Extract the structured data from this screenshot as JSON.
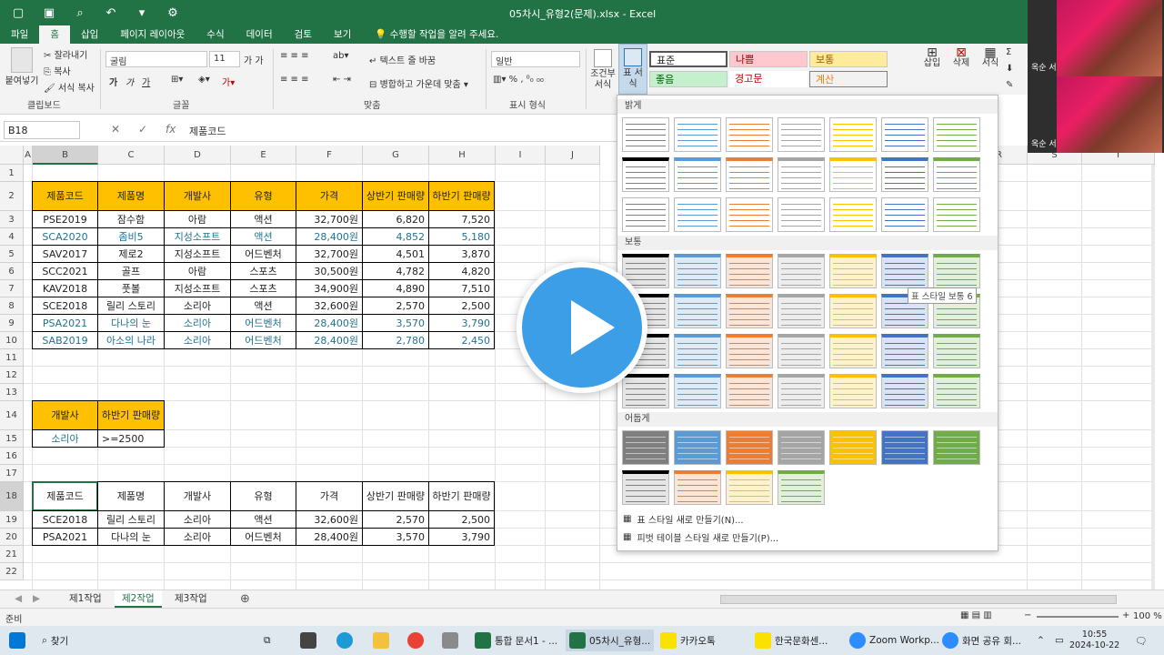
{
  "window": {
    "title": "05차시_유형2(문제).xlsx - Excel"
  },
  "ribbon_tabs": [
    "파일",
    "홈",
    "삽입",
    "페이지 레이아웃",
    "수식",
    "데이터",
    "검토",
    "보기"
  ],
  "tell_me": "수행할 작업을 알려 주세요.",
  "ribbon": {
    "clipboard": {
      "paste": "붙여넣기",
      "cut": "잘라내기",
      "copy": "복사",
      "format_painter": "서식 복사",
      "label": "클립보드"
    },
    "font": {
      "name": "굴림",
      "size": "11",
      "label": "글꼴",
      "bold": "가",
      "italic": "가",
      "underline": "가"
    },
    "alignment": {
      "wrap": "텍스트 줄 바꿈",
      "merge": "병합하고 가운데 맞춤",
      "label": "맞춤"
    },
    "number": {
      "format": "일반",
      "label": "표시 형식"
    },
    "styles": {
      "conditional": "조건부 서식",
      "table": "표 서식"
    },
    "cell_styles": [
      "표준",
      "나쁨",
      "보통",
      "좋음",
      "경고문",
      "계산"
    ],
    "cells": {
      "insert": "삽입",
      "delete": "삭제",
      "format": "서식"
    }
  },
  "formula_bar": {
    "name_box": "B18",
    "content": "제품코드"
  },
  "columns": [
    "A",
    "B",
    "C",
    "D",
    "E",
    "F",
    "G",
    "H",
    "I",
    "J",
    "R",
    "S",
    "T"
  ],
  "rows": [
    "1",
    "2",
    "3",
    "4",
    "5",
    "6",
    "7",
    "8",
    "9",
    "10",
    "11",
    "12",
    "13",
    "14",
    "15",
    "16",
    "17",
    "18",
    "19",
    "20",
    "21",
    "22"
  ],
  "main_table": {
    "headers": [
      "제품코드",
      "제품명",
      "개발사",
      "유형",
      "가격",
      "상반기 판매량",
      "하반기 판매량"
    ],
    "rows": [
      {
        "cells": [
          "PSE2019",
          "잠수함",
          "아람",
          "액션",
          "32,700원",
          "6,820",
          "7,520"
        ],
        "highlight": false
      },
      {
        "cells": [
          "SCA2020",
          "좀비5",
          "지성소프트",
          "액션",
          "28,400원",
          "4,852",
          "5,180"
        ],
        "highlight": true
      },
      {
        "cells": [
          "SAV2017",
          "제로2",
          "지성소프트",
          "어드벤처",
          "32,700원",
          "4,501",
          "3,870"
        ],
        "highlight": false
      },
      {
        "cells": [
          "SCC2021",
          "골프",
          "아람",
          "스포츠",
          "30,500원",
          "4,782",
          "4,820"
        ],
        "highlight": false
      },
      {
        "cells": [
          "KAV2018",
          "풋볼",
          "지성소프트",
          "스포츠",
          "34,900원",
          "4,890",
          "7,510"
        ],
        "highlight": false
      },
      {
        "cells": [
          "SCE2018",
          "릴리 스토리",
          "소리아",
          "액션",
          "32,600원",
          "2,570",
          "2,500"
        ],
        "highlight": false
      },
      {
        "cells": [
          "PSA2021",
          "다나의 눈",
          "소리아",
          "어드벤처",
          "28,400원",
          "3,570",
          "3,790"
        ],
        "highlight": true
      },
      {
        "cells": [
          "SAB2019",
          "아소의 나라",
          "소리아",
          "어드벤처",
          "28,400원",
          "2,780",
          "2,450"
        ],
        "highlight": true
      }
    ]
  },
  "criteria": {
    "headers": [
      "개발사",
      "하반기 판매량"
    ],
    "values": [
      "소리아",
      ">=2500"
    ]
  },
  "result_table": {
    "headers": [
      "제품코드",
      "제품명",
      "개발사",
      "유형",
      "가격",
      "상반기 판매량",
      "하반기 판매량"
    ],
    "rows": [
      [
        "SCE2018",
        "릴리 스토리",
        "소리아",
        "액션",
        "32,600원",
        "2,570",
        "2,500"
      ],
      [
        "PSA2021",
        "다나의 눈",
        "소리아",
        "어드벤처",
        "28,400원",
        "3,570",
        "3,790"
      ]
    ]
  },
  "gallery": {
    "sections": [
      "밝게",
      "보통",
      "어둡게"
    ],
    "tooltip": "표 스타일 보통 6",
    "new_table_style": "표 스타일 새로 만들기(N)...",
    "new_pivot_style": "피벗 테이블 스타일 새로 만들기(P)..."
  },
  "sheets": [
    "제1작업",
    "제2작업",
    "제3작업"
  ],
  "active_sheet": "제2작업",
  "status": {
    "mode": "준비",
    "zoom": "100 %"
  },
  "participants": [
    {
      "name": "옥순 서"
    },
    {
      "name": "옥순 서"
    }
  ],
  "taskbar": {
    "search": "찾기",
    "items": [
      "통합 문서1 - ...",
      "05차시_유형...",
      "카카오톡",
      "한국문화센...",
      "Zoom Workp...",
      "화면 공유 회..."
    ],
    "time": "10:55",
    "date": "2024-10-22"
  },
  "colors": {
    "excel_green": "#217346",
    "header_fill": "#ffc000",
    "teal_text": "#1f7391",
    "play_blue": "#3d9ee8"
  }
}
